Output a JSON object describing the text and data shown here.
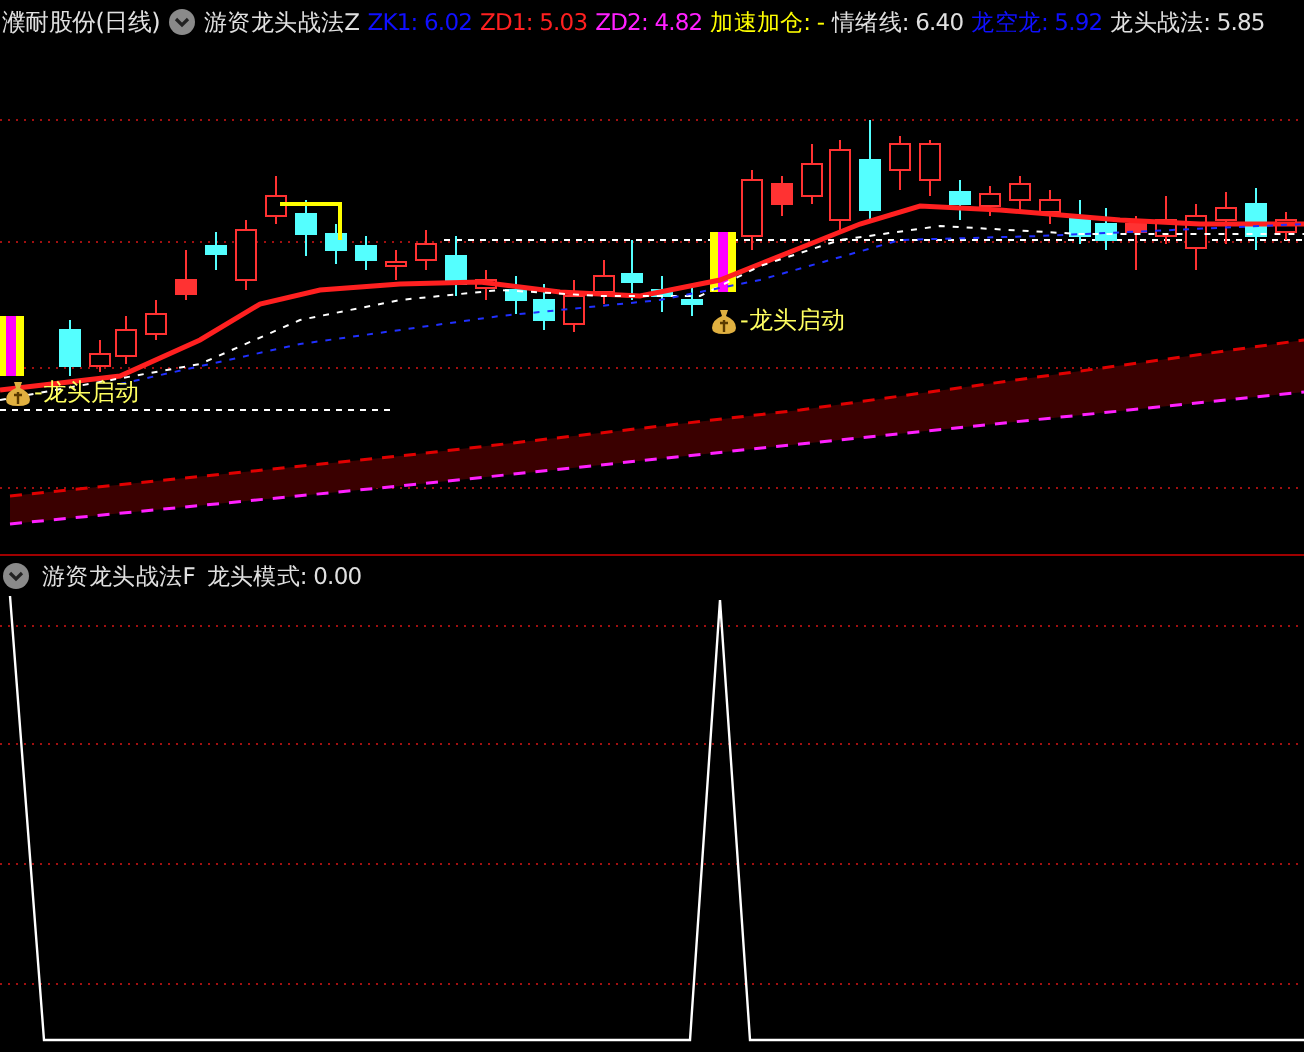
{
  "main_panel": {
    "stock_title": "濮耐股份(日线)",
    "indicator_name": "游资龙头战法Z",
    "readings": [
      {
        "text": "ZK1: 6.02",
        "color": "#1010ff"
      },
      {
        "text": "ZD1: 5.03",
        "color": "#ff2020"
      },
      {
        "text": "ZD2: 4.82",
        "color": "#ff20ff"
      },
      {
        "text": "加速加仓: -",
        "color": "#ffff00"
      },
      {
        "text": "情绪线: 6.40",
        "color": "#e0e0e0"
      },
      {
        "text": "龙空龙: 5.92",
        "color": "#1010ff"
      },
      {
        "text": "龙头战法: 5.85",
        "color": "#e0e0e0"
      }
    ],
    "signals": [
      {
        "text": "-龙头启动"
      },
      {
        "text": "-龙头启动"
      }
    ]
  },
  "sub_panel": {
    "indicator_name": "游资龙头战法F",
    "reading": "龙头模式: 0.00"
  }
}
